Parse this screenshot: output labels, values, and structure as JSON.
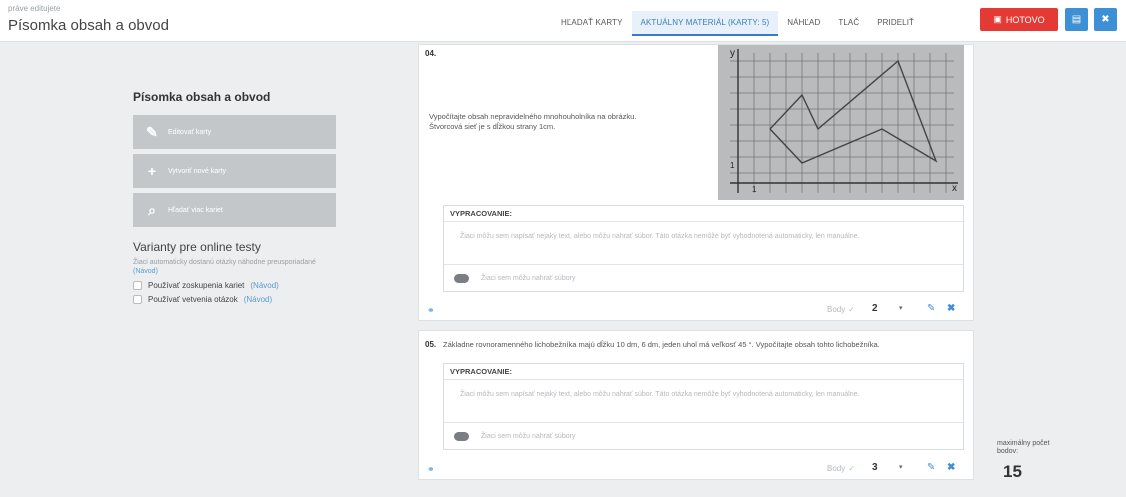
{
  "header": {
    "editing_label": "práve editujete",
    "doc_title": "Písomka obsah a obvod",
    "tabs": [
      {
        "label": "HĽADAŤ KARTY"
      },
      {
        "label": "AKTUÁLNY MATERIÁL (KARTY: 5)"
      },
      {
        "label": "NÁHĽAD"
      },
      {
        "label": "TLAČ"
      },
      {
        "label": "PRIDELIŤ"
      }
    ],
    "done_label": "HOTOVO",
    "active_tab_color": "#3a7cc1",
    "done_color": "#e53935"
  },
  "sidebar": {
    "title": "Písomka obsah a obvod",
    "buttons": [
      {
        "label": "Editovať karty",
        "icon": "pencil-icon"
      },
      {
        "label": "Vytvoriť nové karty",
        "icon": "plus-icon"
      },
      {
        "label": "Hľadať viac kariet",
        "icon": "search-icon"
      }
    ],
    "variants_title": "Varianty pre online testy",
    "variants_desc": "Žiaci automaticky dostanú otázky náhodne preusporiadané",
    "variants_link": "(Návod)",
    "options": [
      {
        "label": "Používať zoskupenia kariet",
        "link": "(Návod)"
      },
      {
        "label": "Používať vetvenia otázok",
        "link": "(Návod)"
      }
    ]
  },
  "cards": [
    {
      "number": "04.",
      "text": "Vypočítajte obsah nepravidelného mnohouholníka na obrázku. Štvorcová sieť je s dĺžkou strany 1cm.",
      "answer_header": "VYPRACOVANIE:",
      "answer_placeholder": "Žiaci môžu sem napísať nejaký text, alebo môžu nahrať súbor. Táto otázka nemôže byť vyhodnotená automaticky, len manuálne.",
      "upload_text": "Žiaci sem môžu nahrať súbory",
      "body_label": "Body",
      "points": "2",
      "graph_labels": {
        "y": "y",
        "x": "x",
        "one_x": "1",
        "one_y": "1"
      }
    },
    {
      "number": "05.",
      "text": "Základne rovnoramenného lichobežníka majú dĺžku 10 dm, 6 dm, jeden uhol má veľkosť 45 °. Vypočítajte obsah tohto lichobežníka.",
      "answer_header": "VYPRACOVANIE:",
      "answer_placeholder": "Žiaci môžu sem napísať nejaký text, alebo môžu nahrať súbor. Táto otázka nemôže byť vyhodnotená automaticky, len manuálne.",
      "upload_text": "Žiaci sem môžu nahrať súbory",
      "body_label": "Body",
      "points": "3"
    }
  ],
  "summary": {
    "max_points_label": "maximálny počet bodov:",
    "max_points": "15"
  }
}
